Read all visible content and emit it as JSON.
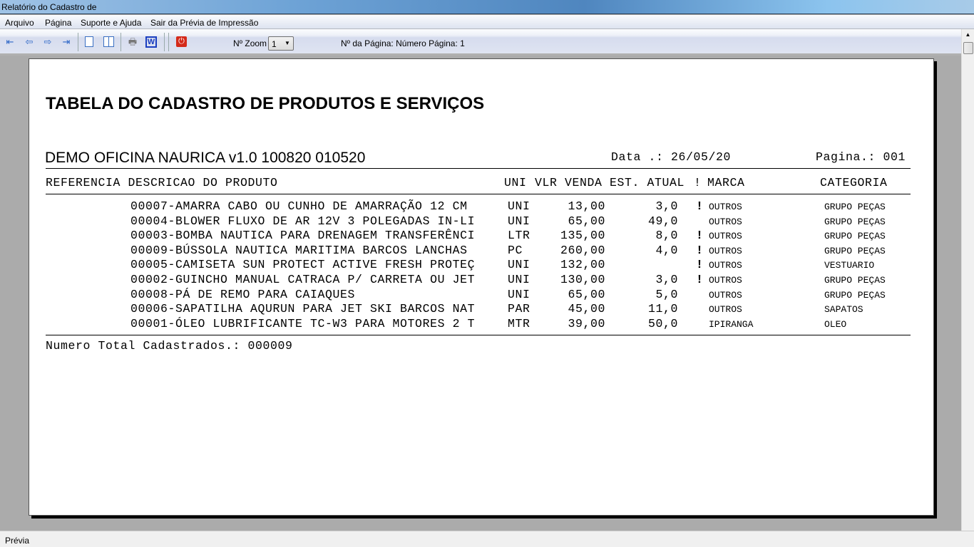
{
  "window": {
    "title": "Relatório do Cadastro de"
  },
  "menu": [
    "Arquivo",
    "Página",
    "Suporte e Ajuda",
    "Sair da Prévia de Impressão"
  ],
  "toolbar": {
    "zoom_label": "Nº Zoom",
    "zoom_value": "1",
    "page_info": "Nº da Página: Número Página: 1"
  },
  "report": {
    "title": "TABELA DO CADASTRO DE PRODUTOS E SERVIÇOS",
    "company": "DEMO OFICINA NAURICA v1.0 100820 010520",
    "date": "Data .: 26/05/20",
    "page": "Pagina.: 001",
    "headers": {
      "ref_desc": "REFERENCIA DESCRICAO DO PRODUTO",
      "uni": "UNI",
      "vlr": "VLR VENDA",
      "est": "EST. ATUAL",
      "flag": "!",
      "marca": "MARCA",
      "categoria": "CATEGORIA"
    },
    "rows": [
      {
        "desc": "00007-AMARRA CABO OU CUNHO DE AMARRAÇÃO 12 CM",
        "uni": "UNI",
        "vlr": "13,00",
        "est": "3,0",
        "flag": "!",
        "marca": "OUTROS",
        "cat": "GRUPO PEÇAS"
      },
      {
        "desc": "00004-BLOWER FLUXO DE AR 12V 3 POLEGADAS IN-LI",
        "uni": "UNI",
        "vlr": "65,00",
        "est": "49,0",
        "flag": "",
        "marca": "OUTROS",
        "cat": "GRUPO PEÇAS"
      },
      {
        "desc": "00003-BOMBA NAUTICA PARA DRENAGEM TRANSFERÊNCI",
        "uni": "LTR",
        "vlr": "135,00",
        "est": "8,0",
        "flag": "!",
        "marca": "OUTROS",
        "cat": "GRUPO PEÇAS"
      },
      {
        "desc": "00009-BÚSSOLA NAUTICA MARITIMA BARCOS LANCHAS",
        "uni": "PC",
        "vlr": "260,00",
        "est": "4,0",
        "flag": "!",
        "marca": "OUTROS",
        "cat": "GRUPO PEÇAS"
      },
      {
        "desc": "00005-CAMISETA SUN PROTECT ACTIVE FRESH PROTEÇ",
        "uni": "UNI",
        "vlr": "132,00",
        "est": "",
        "flag": "!",
        "marca": "OUTROS",
        "cat": "VESTUARIO"
      },
      {
        "desc": "00002-GUINCHO MANUAL CATRACA P/ CARRETA OU JET",
        "uni": "UNI",
        "vlr": "130,00",
        "est": "3,0",
        "flag": "!",
        "marca": "OUTROS",
        "cat": "GRUPO PEÇAS"
      },
      {
        "desc": "00008-PÁ DE REMO PARA CAIAQUES",
        "uni": "UNI",
        "vlr": "65,00",
        "est": "5,0",
        "flag": "",
        "marca": "OUTROS",
        "cat": "GRUPO PEÇAS"
      },
      {
        "desc": "00006-SAPATILHA AQURUN PARA JET SKI BARCOS NAT",
        "uni": "PAR",
        "vlr": "45,00",
        "est": "11,0",
        "flag": "",
        "marca": "OUTROS",
        "cat": "SAPATOS"
      },
      {
        "desc": "00001-ÓLEO LUBRIFICANTE TC-W3 PARA MOTORES 2 T",
        "uni": "MTR",
        "vlr": "39,00",
        "est": "50,0",
        "flag": "",
        "marca": "IPIRANGA",
        "cat": "OLEO"
      }
    ],
    "total": "Numero Total Cadastrados.: 000009"
  },
  "status": "Prévia"
}
